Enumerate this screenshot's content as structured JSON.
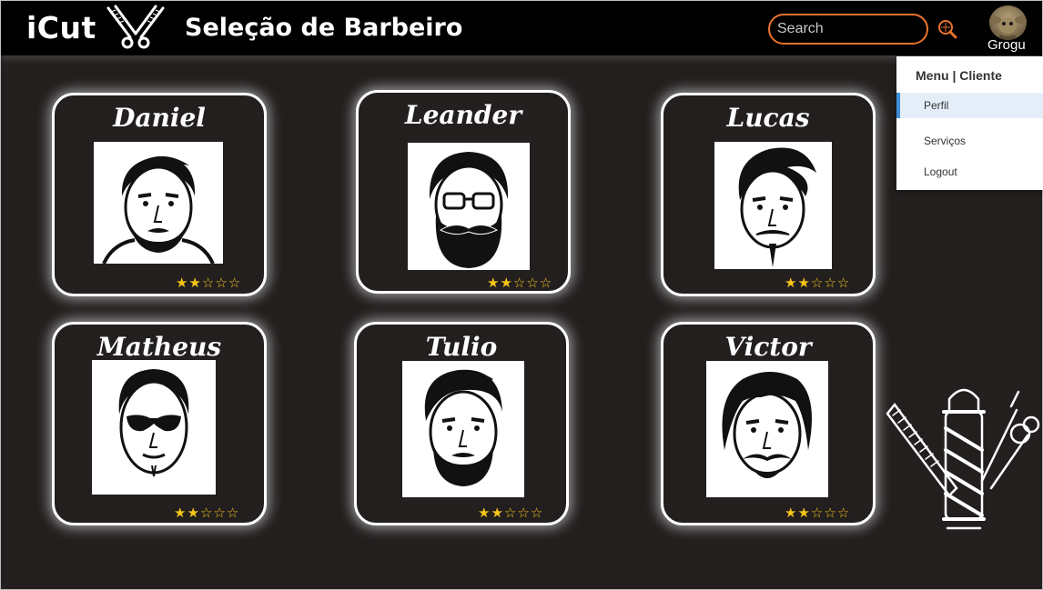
{
  "header": {
    "logo": "iCut",
    "title": "Seleção de Barbeiro",
    "search_placeholder": "Search",
    "user_name": "Grogu"
  },
  "menu": {
    "title": "Menu | Cliente",
    "items": [
      {
        "label": "Perfil",
        "active": true
      },
      {
        "label": "Serviços",
        "active": false
      },
      {
        "label": "Logout",
        "active": false
      }
    ]
  },
  "barbers": [
    {
      "name": "Daniel",
      "rating": 2,
      "max_rating": 5
    },
    {
      "name": "Leander",
      "rating": 2,
      "max_rating": 5
    },
    {
      "name": "Lucas",
      "rating": 2,
      "max_rating": 5
    },
    {
      "name": "Matheus",
      "rating": 2,
      "max_rating": 5
    },
    {
      "name": "Tulio",
      "rating": 2,
      "max_rating": 5
    },
    {
      "name": "Victor",
      "rating": 2,
      "max_rating": 5
    }
  ],
  "colors": {
    "accent": "#e8732c",
    "star": "#f5c518",
    "background": "#231f1f",
    "header": "#000000",
    "menu_active": "#3d8fd8"
  }
}
